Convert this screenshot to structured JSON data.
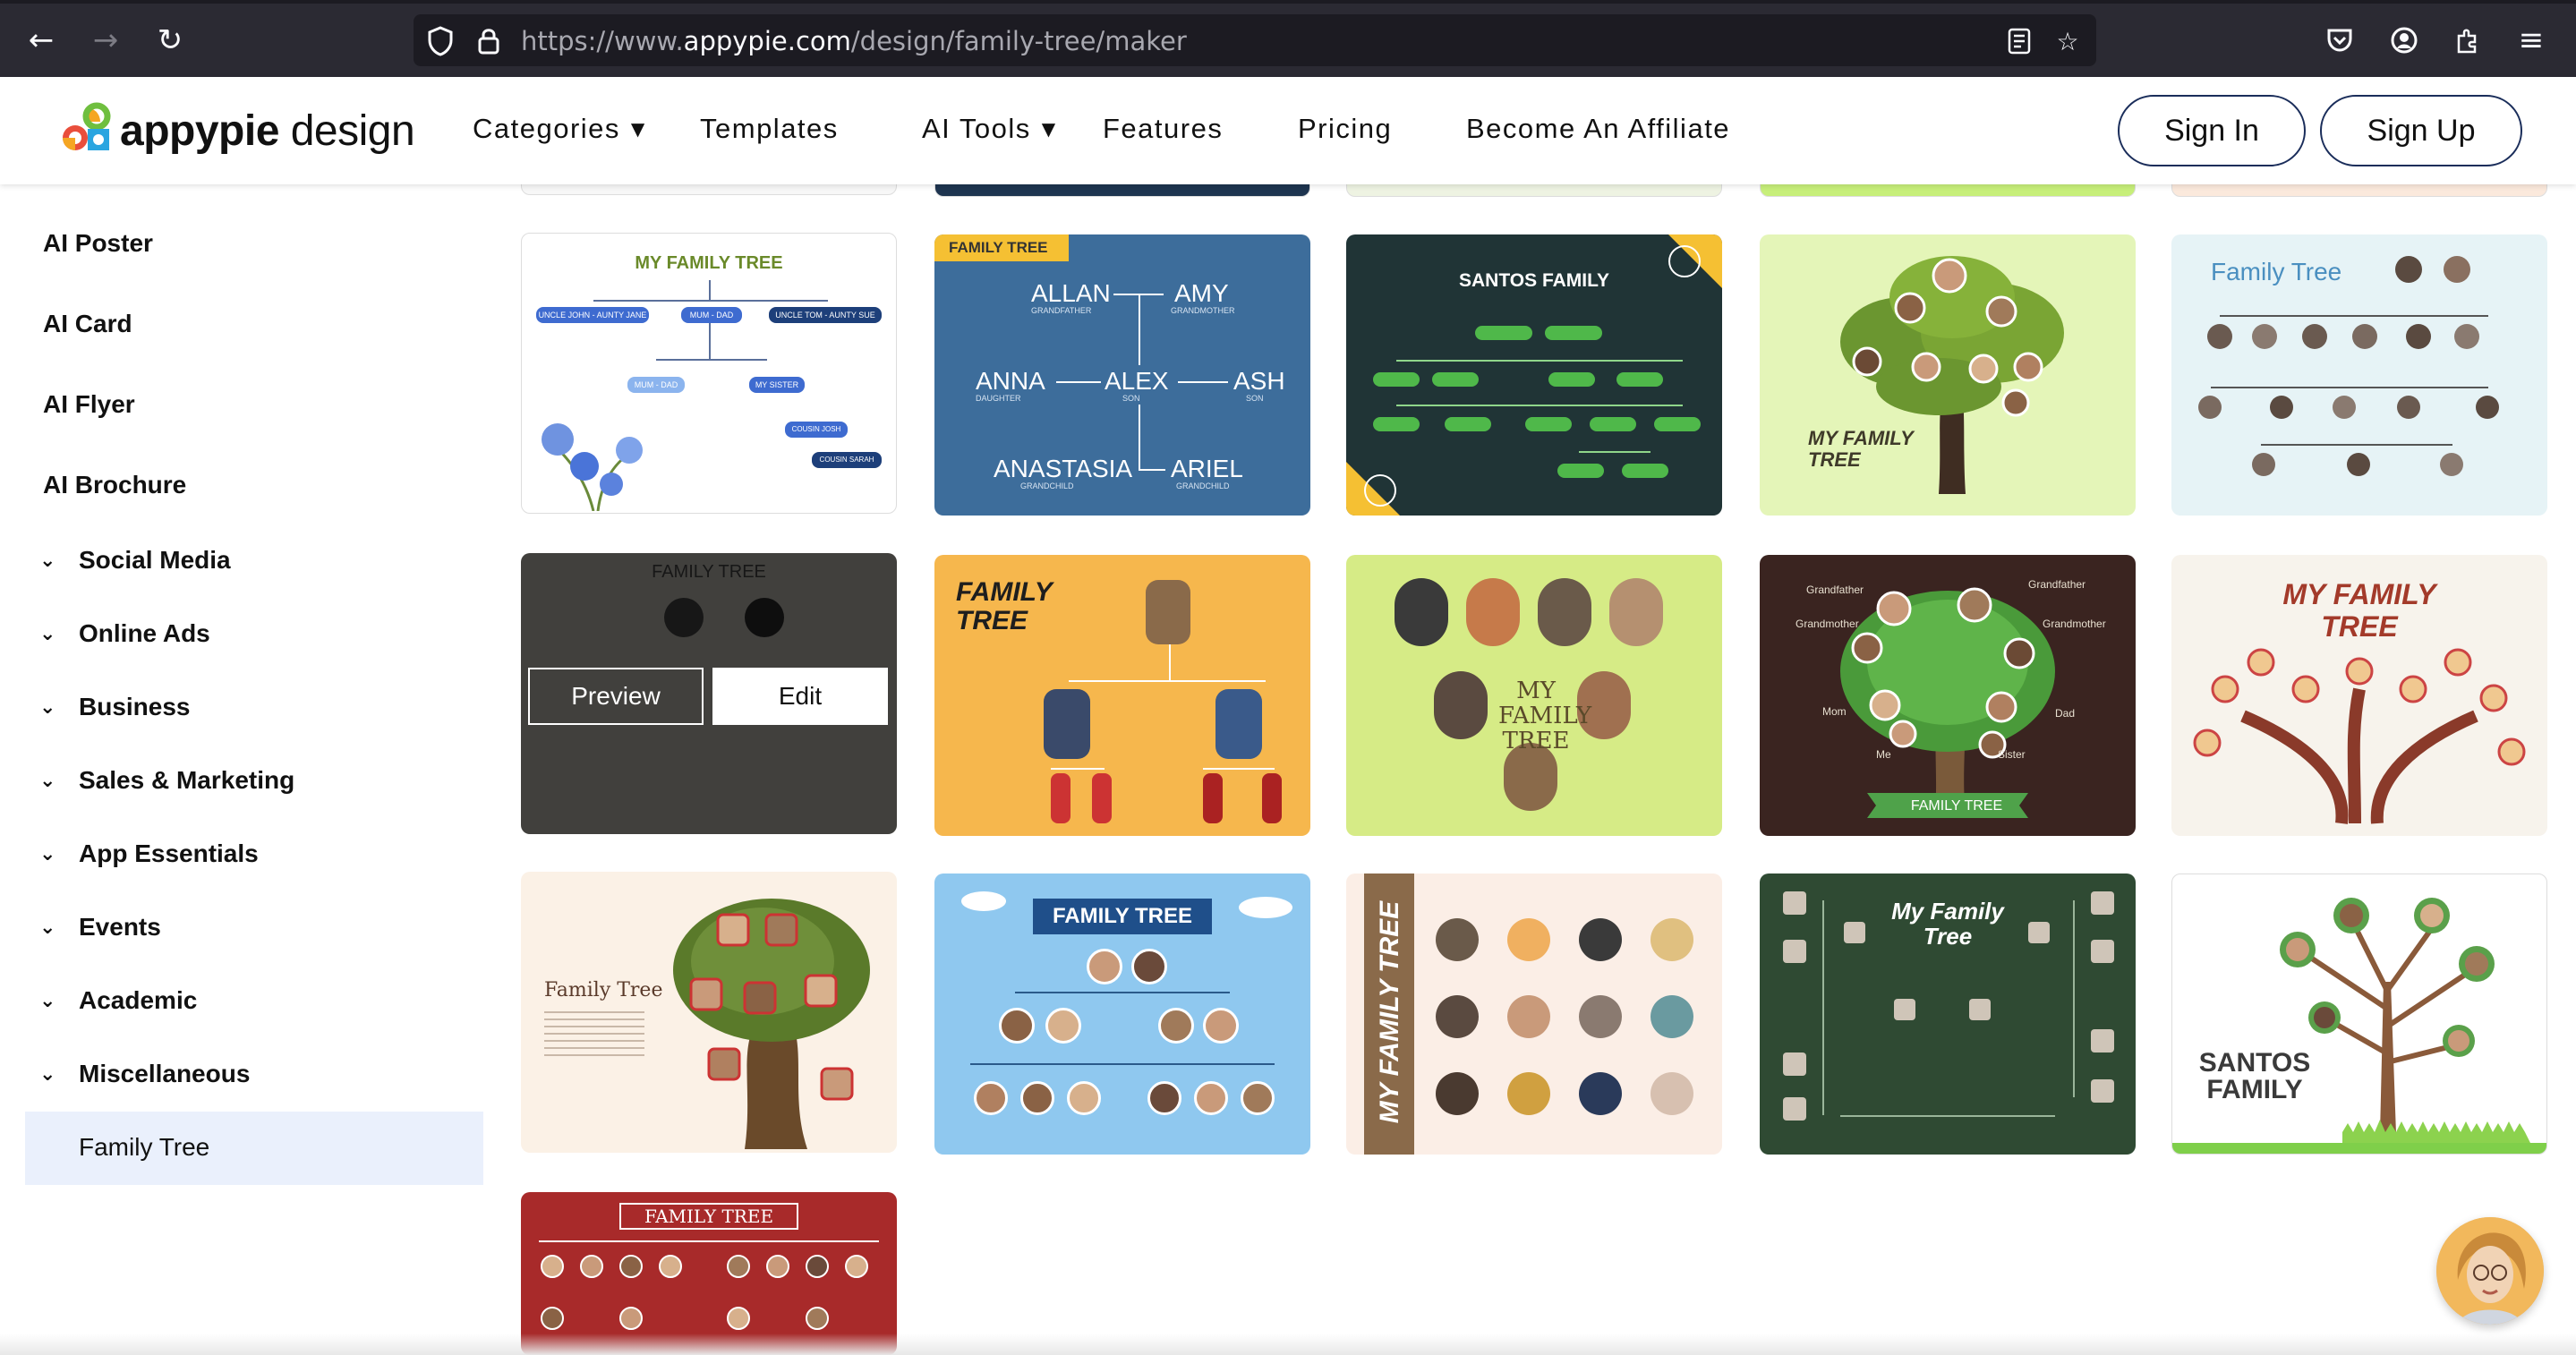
{
  "browser": {
    "url_prefix": "https://www.",
    "url_domain": "appypie.com",
    "url_path": "/design/family-tree/maker",
    "icons": [
      "back-icon",
      "forward-icon",
      "reload-icon",
      "shield-icon",
      "lock-icon",
      "reader-icon",
      "star-icon",
      "pocket-icon",
      "account-icon",
      "extensions-icon",
      "menu-icon"
    ]
  },
  "header": {
    "logo_bold": "appypie",
    "logo_light": "design",
    "nav": [
      "Categories",
      "Templates",
      "AI Tools",
      "Features",
      "Pricing",
      "Become An Affiliate"
    ],
    "sign_in": "Sign In",
    "sign_up": "Sign Up"
  },
  "sidebar": {
    "ai_items": [
      "AI Poster",
      "AI Card",
      "AI Flyer",
      "AI Brochure"
    ],
    "categories": [
      "Social Media",
      "Online Ads",
      "Business",
      "Sales & Marketing",
      "App Essentials",
      "Events",
      "Academic",
      "Miscellaneous"
    ],
    "active": "Family Tree"
  },
  "templates": {
    "hover_preview": "Preview",
    "hover_edit": "Edit",
    "t1_title": "MY FAMILY TREE",
    "t1_pills": [
      "UNCLE JOHN - AUNTY JANE",
      "MUM - DAD",
      "UNCLE TOM - AUNTY SUE",
      "MUM - DAD",
      "MY SISTER",
      "COUSIN JOSH",
      "COUSIN SARAH"
    ],
    "t2_tag": "FAMILY TREE",
    "t2_names": [
      "ALLAN",
      "AMY",
      "ANNA",
      "ALEX",
      "ASH",
      "ANASTASIA",
      "ARIEL"
    ],
    "t2_roles": [
      "GRANDFATHER",
      "GRANDMOTHER",
      "DAUGHTER",
      "SON",
      "SON",
      "GRANDCHILD",
      "GRANDCHILD"
    ],
    "t3_title": "SANTOS FAMILY",
    "t4_title": "MY FAMILY TREE",
    "t5_title": "Family Tree",
    "t6_title": "FAMILY TREE",
    "t7_title": "MY FAMILY TREE",
    "t8_title": "Family Tree",
    "t9_labels": [
      "Grandfather",
      "Grandfather",
      "Grandmother",
      "Grandmother",
      "Mom",
      "Dad",
      "Me",
      "Sister"
    ],
    "t9_banner": "FAMILY TREE",
    "t10_title": "MY FAMILY TREE",
    "t11_title": "Family Tree",
    "t12_title": "FAMILY TREE",
    "t13_title": "MY FAMILY TREE",
    "t14_title": "My Family Tree",
    "t15_title": "SANTOS FAMILY",
    "t16_title": "FAMILY TREE"
  },
  "colors": {
    "brand_navy": "#1a2d5a",
    "active_bg": "#eaf0fc",
    "chrome_bg": "#2b2a33"
  }
}
